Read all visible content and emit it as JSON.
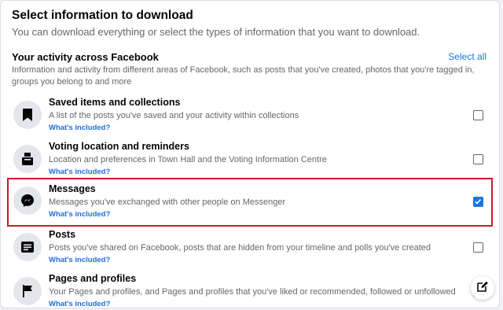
{
  "header": {
    "title": "Select information to download",
    "subtitle": "You can download everything or select the types of information that you want to download."
  },
  "section": {
    "title": "Your activity across Facebook",
    "select_all_label": "Select all",
    "description": "Information and activity from different areas of Facebook, such as posts that you've created, photos that you're tagged in, groups you belong to and more"
  },
  "items": [
    {
      "title": "Saved items and collections",
      "description": "A list of the posts you've saved and your activity within collections",
      "link": "What's included?",
      "icon": "bookmark-icon",
      "checked": false
    },
    {
      "title": "Voting location and reminders",
      "description": "Location and preferences in Town Hall and the Voting Information Centre",
      "link": "What's included?",
      "icon": "ballot-box-icon",
      "checked": false
    },
    {
      "title": "Messages",
      "description": "Messages you've exchanged with other people on Messenger",
      "link": "What's included?",
      "icon": "messenger-icon",
      "checked": true
    },
    {
      "title": "Posts",
      "description": "Posts you've shared on Facebook, posts that are hidden from your timeline and polls you've created",
      "link": "What's included?",
      "icon": "post-icon",
      "checked": false
    },
    {
      "title": "Pages and profiles",
      "description": "Your Pages and profiles, and Pages and profiles that you've liked or recommended, followed or unfollowed",
      "link": "What's included?",
      "icon": "flag-icon",
      "checked": false
    }
  ],
  "colors": {
    "accent": "#1b74e4",
    "highlight_border": "#d5182a"
  }
}
